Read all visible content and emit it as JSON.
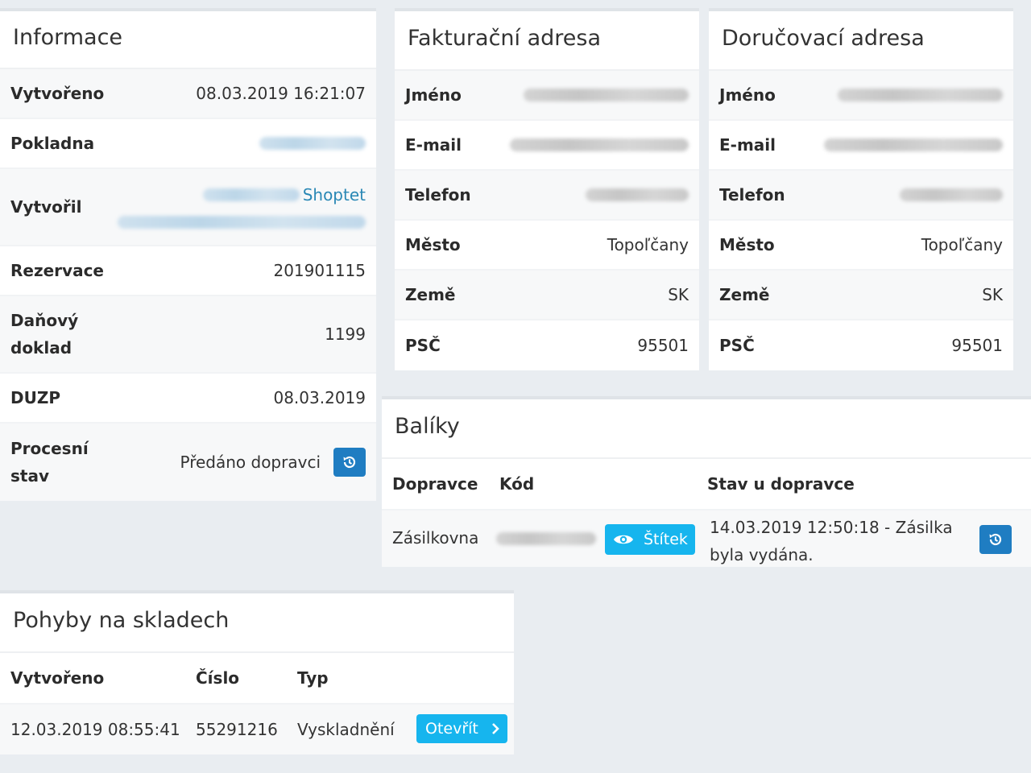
{
  "info": {
    "title": "Informace",
    "rows": {
      "created": {
        "label": "Vytvořeno",
        "value": "08.03.2019 16:21:07"
      },
      "register": {
        "label": "Pokladna"
      },
      "creator": {
        "label": "Vytvořil",
        "link": "Shoptet"
      },
      "reservation": {
        "label": "Rezervace",
        "value": "201901115"
      },
      "tax_doc": {
        "label": "Daňový doklad",
        "value": "1199"
      },
      "duzp": {
        "label": "DUZP",
        "value": "08.03.2019"
      },
      "process": {
        "label": "Procesní stav",
        "value": "Předáno dopravci"
      }
    }
  },
  "billing": {
    "title": "Fakturační adresa",
    "name_label": "Jméno",
    "email_label": "E-mail",
    "phone_label": "Telefon",
    "city_label": "Město",
    "city": "Topoľčany",
    "country_label": "Země",
    "country": "SK",
    "zip_label": "PSČ",
    "zip": "95501"
  },
  "delivery": {
    "title": "Doručovací adresa",
    "name_label": "Jméno",
    "email_label": "E-mail",
    "phone_label": "Telefon",
    "city_label": "Město",
    "city": "Topoľčany",
    "country_label": "Země",
    "country": "SK",
    "zip_label": "PSČ",
    "zip": "95501"
  },
  "packages": {
    "title": "Balíky",
    "columns": {
      "carrier": "Dopravce",
      "code": "Kód",
      "status": "Stav u dopravce"
    },
    "row": {
      "carrier": "Zásilkovna",
      "label_button": "Štítek",
      "status": "14.03.2019 12:50:18 - Zásilka byla vydána."
    }
  },
  "stock": {
    "title": "Pohyby na skladech",
    "columns": {
      "created": "Vytvořeno",
      "number": "Číslo",
      "type": "Typ"
    },
    "row": {
      "created": "12.03.2019 08:55:41",
      "number": "55291216",
      "type": "Vyskladnění",
      "open_button": "Otevřít"
    }
  },
  "colors": {
    "primary": "#1f7dc2",
    "cyan": "#16b5ee",
    "link": "#2a88b5",
    "background": "#e9edf1"
  },
  "icons": [
    "history-icon",
    "eye-icon",
    "chevron-right-icon"
  ]
}
